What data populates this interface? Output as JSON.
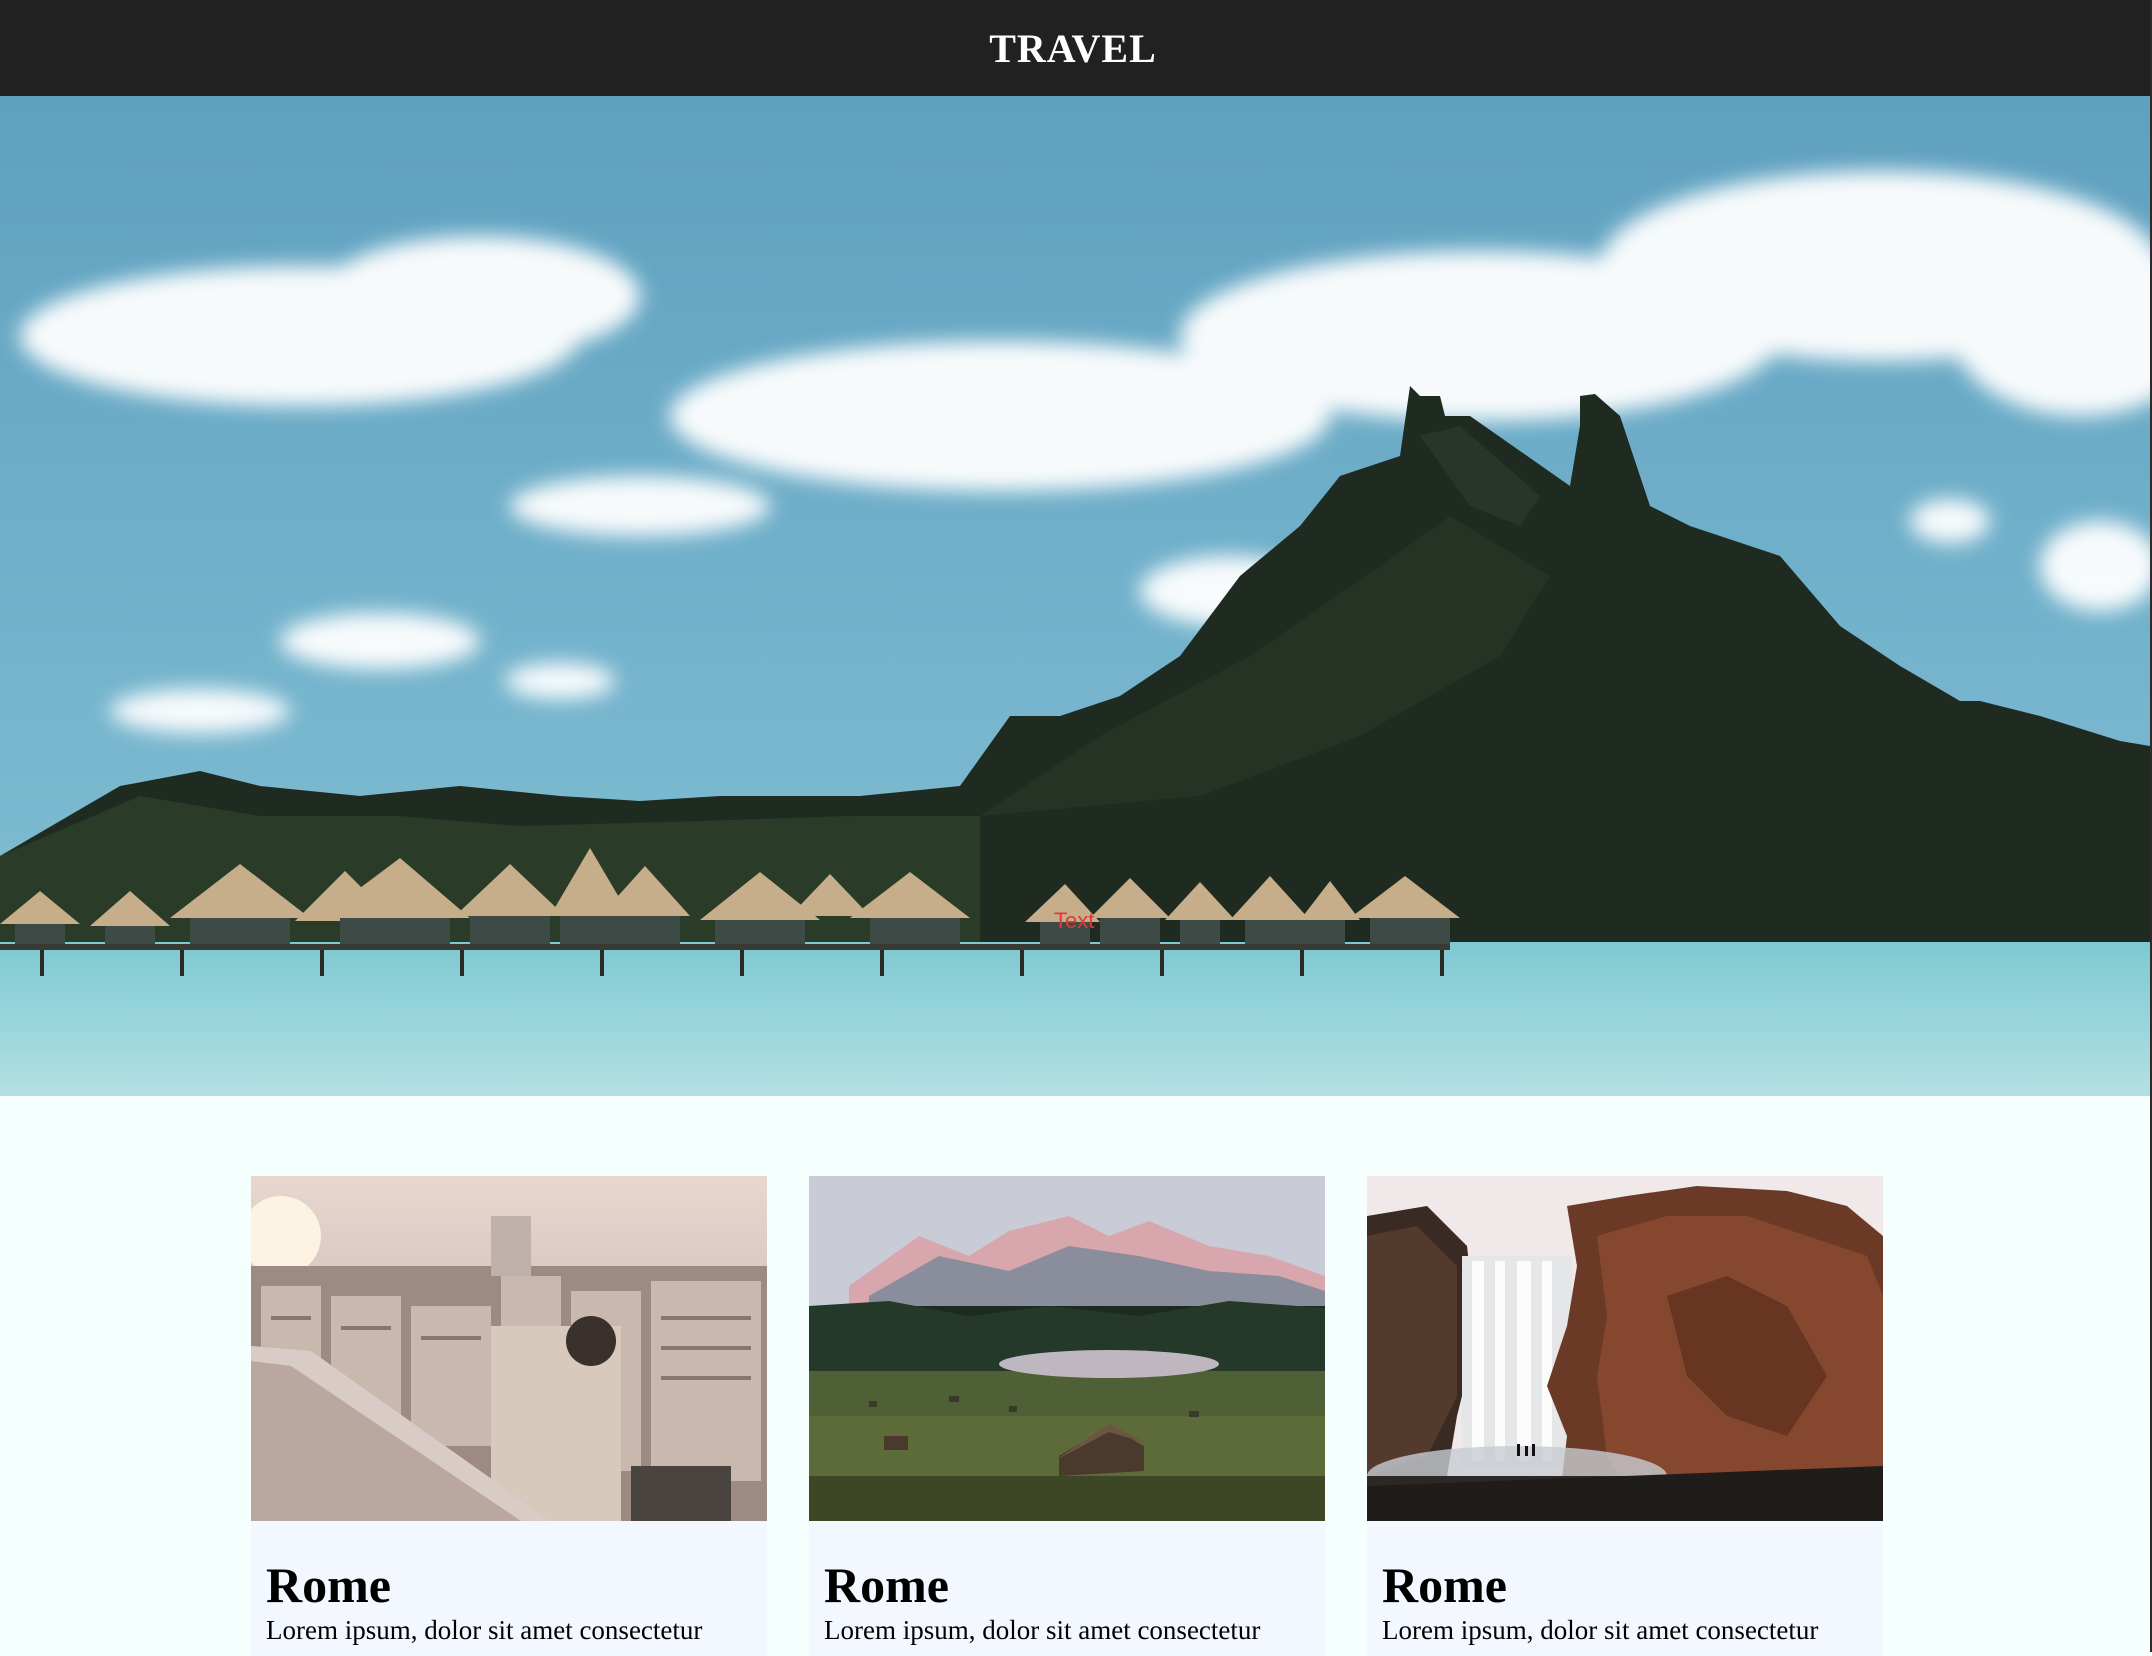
{
  "header": {
    "title": "TRAVEL"
  },
  "hero": {
    "overlay_text": "Text",
    "image": "tropical-island-overwater-bungalows-image"
  },
  "cards": [
    {
      "image": "city-rooftops-image",
      "title": "Rome",
      "text": "Lorem ipsum, dolor sit amet consectetur"
    },
    {
      "image": "mountain-meadow-image",
      "title": "Rome",
      "text": "Lorem ipsum, dolor sit amet consectetur"
    },
    {
      "image": "waterfall-cliff-image",
      "title": "Rome",
      "text": "Lorem ipsum, dolor sit amet consectetur"
    }
  ],
  "colors": {
    "header_bg": "#212121",
    "page_bg": "#f5fffe",
    "card_bg": "#f3f7ff",
    "overlay_text": "#e53935"
  }
}
